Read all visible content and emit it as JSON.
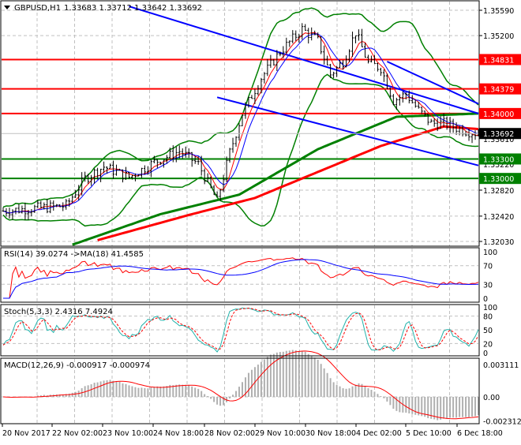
{
  "header": {
    "symbol": "GBPUSD,H1",
    "ohlc": "1.33683 1.33712 1.33642 1.33692"
  },
  "colors": {
    "candle": "#000000",
    "resistance": "#ff0000",
    "support": "#008000",
    "trend": "#0000ff",
    "ma_fast": "#008000",
    "ma_slow": "#ff0000",
    "bands": "#008000",
    "stoch_main": "#20b2aa",
    "current_price_bg": "#000000"
  },
  "chart_data": [
    {
      "type": "line",
      "title": "GBPUSD,H1",
      "ylim": [
        1.3203,
        1.3559
      ],
      "price_ticks": [
        "1.35590",
        "1.35200",
        "1.32820",
        "1.32420",
        "1.32030"
      ],
      "x_labels": [
        "20 Nov 2017",
        "22 Nov 02:00",
        "23 Nov 10:00",
        "24 Nov 18:00",
        "28 Nov 02:00",
        "29 Nov 10:00",
        "30 Nov 18:00",
        "4 Dec 02:00",
        "5 Dec 10:00",
        "6 Dec 18:00"
      ],
      "close_keypoints": {
        "bar": [
          0,
          20,
          26,
          32,
          40,
          48,
          56,
          62,
          68,
          72,
          76,
          82,
          88,
          95,
          100,
          104,
          108,
          112,
          116,
          120,
          124,
          128,
          132,
          136,
          140,
          144,
          148,
          151
        ],
        "price": [
          1.325,
          1.3258,
          1.33,
          1.3318,
          1.3302,
          1.3325,
          1.3342,
          1.3322,
          1.3265,
          1.334,
          1.34,
          1.3455,
          1.3495,
          1.353,
          1.3512,
          1.346,
          1.348,
          1.3525,
          1.3478,
          1.347,
          1.342,
          1.343,
          1.3405,
          1.3385,
          1.3385,
          1.3378,
          1.3372,
          1.3369
        ]
      },
      "levels": [
        {
          "value": 1.34831,
          "label": "1.34831",
          "kind": "resistance"
        },
        {
          "value": 1.34379,
          "label": "1.34379",
          "kind": "resistance"
        },
        {
          "value": 1.34,
          "label": "1.34000",
          "kind": "resistance"
        },
        {
          "value": 1.333,
          "label": "1.33300",
          "kind": "support"
        },
        {
          "value": 1.33,
          "label": "1.33000",
          "kind": "support"
        }
      ],
      "current_price": {
        "value": 1.33692,
        "label": "1.33692"
      },
      "hidden_tick_labels": [
        "1.33610",
        "1.33220"
      ],
      "ma_fast_keypoints": {
        "bar": [
          22,
          50,
          75,
          100,
          125,
          151
        ],
        "price": [
          1.3198,
          1.3245,
          1.3275,
          1.3345,
          1.3395,
          1.34
        ]
      },
      "ma_slow_keypoints": {
        "bar": [
          30,
          60,
          80,
          100,
          120,
          140,
          151
        ],
        "price": [
          1.3205,
          1.3245,
          1.327,
          1.331,
          1.335,
          1.338,
          1.3376
        ]
      },
      "trendlines": [
        {
          "from": [
            40,
            1.3565
          ],
          "to": [
            151,
            1.34
          ]
        },
        {
          "from": [
            68,
            1.3425
          ],
          "to": [
            151,
            1.332
          ]
        },
        {
          "from": [
            122,
            1.348
          ],
          "to": [
            151,
            1.3415
          ]
        }
      ]
    },
    {
      "type": "line",
      "title": "RSI(14) 39.0274  ->MA(18) 41.4585",
      "ylim": [
        0,
        100
      ],
      "ticks": [
        "100",
        "70",
        "30",
        "0"
      ],
      "levels": [
        70,
        30
      ]
    },
    {
      "type": "line",
      "title": "Stoch(5,3,3) 2.4316 7.4924",
      "ylim": [
        0,
        100
      ],
      "ticks": [
        "100",
        "80",
        "50",
        "20",
        "0"
      ],
      "levels": [
        80,
        20
      ]
    },
    {
      "type": "bar",
      "title": "MACD(12,26,9) -0.000917 -0.000974",
      "ylim": [
        -0.002312,
        0.003111
      ],
      "ticks": [
        "0.003111",
        "0.00",
        "-0.002312"
      ]
    }
  ]
}
